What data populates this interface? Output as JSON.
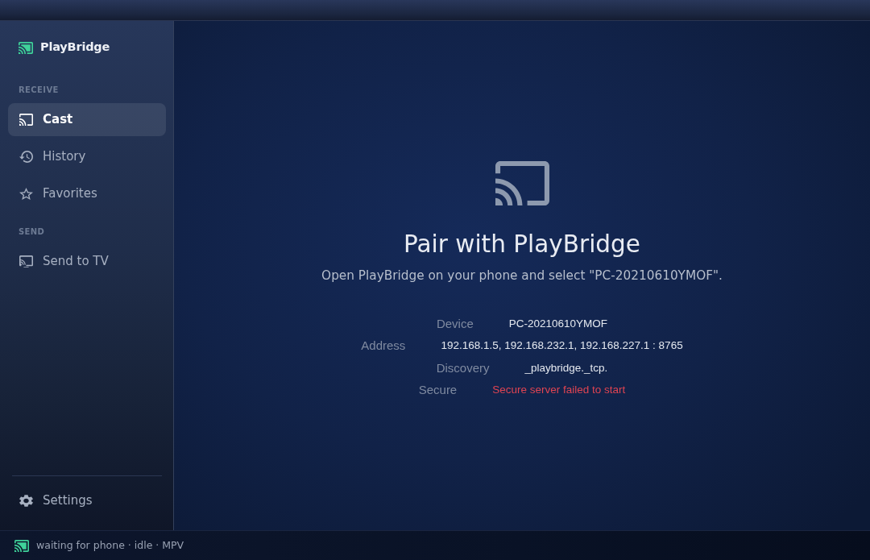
{
  "app": {
    "name": "PlayBridge"
  },
  "sidebar": {
    "sections": [
      {
        "heading": "RECEIVE",
        "items": [
          {
            "label": "Cast",
            "selected": true
          },
          {
            "label": "History",
            "selected": false
          },
          {
            "label": "Favorites",
            "selected": false
          }
        ]
      },
      {
        "heading": "SEND",
        "items": [
          {
            "label": "Send to TV",
            "selected": false
          }
        ]
      }
    ],
    "footer_items": [
      {
        "label": "Settings",
        "selected": false
      }
    ]
  },
  "pairing": {
    "title": "Pair with PlayBridge",
    "subtitle": "Open PlayBridge on your phone and select \"PC-20210610YMOF\".",
    "details": [
      {
        "label": "Device",
        "value": "PC-20210610YMOF",
        "error": false
      },
      {
        "label": "Address",
        "value": "192.168.1.5, 192.168.232.1, 192.168.227.1 : 8765",
        "error": false
      },
      {
        "label": "Discovery",
        "value": "_playbridge._tcp.",
        "error": false
      },
      {
        "label": "Secure",
        "value": "Secure server failed to start",
        "error": true
      }
    ]
  },
  "status_bar": {
    "text": "waiting for phone · idle · MPV"
  }
}
